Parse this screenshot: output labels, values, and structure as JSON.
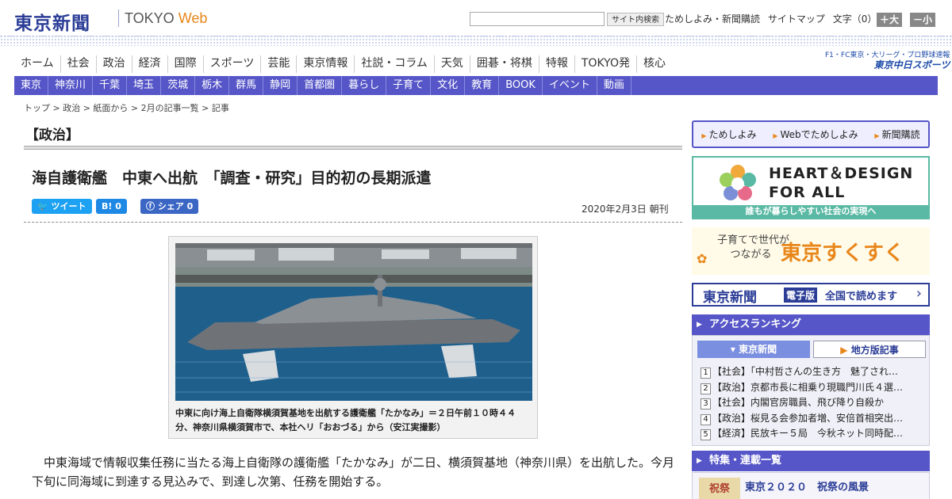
{
  "header": {
    "logo": "東京新聞",
    "logo_tokyo": "TOKYO",
    "logo_web": "Web",
    "search_button": "サイト内検索",
    "links": [
      "ためしよみ・新聞購読",
      "サイトマップ",
      "文字（0）"
    ],
    "size_up": "＋大",
    "size_down": "－小"
  },
  "nav_main": [
    "ホーム",
    "社会",
    "政治",
    "経済",
    "国際",
    "スポーツ",
    "芸能",
    "東京情報",
    "社説・コラム",
    "天気",
    "囲碁・将棋",
    "特報",
    "TOKYO発",
    "核心"
  ],
  "chunichi": {
    "top": "F1・FC東京・大リーグ・プロ野球速報",
    "brand": "東京中日スポーツ"
  },
  "nav_region": [
    "東京",
    "神奈川",
    "千葉",
    "埼玉",
    "茨城",
    "栃木",
    "群馬",
    "静岡",
    "首都圏",
    "暮らし",
    "子育て",
    "文化",
    "教育",
    "BOOK",
    "イベント",
    "動画"
  ],
  "breadcrumb": "トップ > 政治 > 紙面から > 2月の記事一覧 > 記事",
  "section": "【政治】",
  "article": {
    "headline": "海自護衛艦　中東へ出航　「調査・研究」目的初の長期派遣",
    "date": "2020年2月3日 朝刊",
    "caption": "中東に向け海上自衛隊横須賀基地を出航する護衛艦「たかなみ」＝２日午前１０時４４分、神奈川県横須賀市で、本社ヘリ「おおづる」から（安江実撮影）",
    "body": "中東海域で情報収集任務に当たる海上自衛隊の護衛艦「たかなみ」が二日、横須賀基地（神奈川県）を出航した。今月下旬に同海域に到達する見込みで、到達し次第、任務を開始する。"
  },
  "share": {
    "tweet": "ツイート",
    "hatena": "B! 0",
    "facebook": "シェア 0"
  },
  "sidebar": {
    "promo": [
      "ためしよみ",
      "Webでためしよみ",
      "新聞購読"
    ],
    "heart_title_1": "HEART＆DESIGN",
    "heart_title_2": "FOR ALL",
    "heart_sub": "誰もが暮らしやすい社会の実現へ",
    "suku_a": "子育てで世代が",
    "suku_b": "つながる",
    "suku_brand": "東京すくすく",
    "denshi_logo": "東京新聞",
    "denshi_tag": "電子版",
    "denshi_text": "全国で読めます",
    "ranking_title": "アクセスランキング",
    "tab_tokyo": "東京新聞",
    "tab_local": "地方版記事",
    "ranking": [
      {
        "n": "1",
        "text": "【社会】「中村哲さんの生き方　魅了され…"
      },
      {
        "n": "2",
        "text": "【政治】京都市長に相乗り現職門川氏４選…"
      },
      {
        "n": "3",
        "text": "【社会】内閣官房職員、飛び降り自殺か"
      },
      {
        "n": "4",
        "text": "【政治】桜見る会参加者増、安倍首相突出…"
      },
      {
        "n": "5",
        "text": "【経済】民放キー５局　今秋ネット同時配…"
      }
    ],
    "feature_title": "特集・連載一覧",
    "feature_item": "東京２０２０　祝祭の風景",
    "feature_thumb": "祝祭"
  }
}
